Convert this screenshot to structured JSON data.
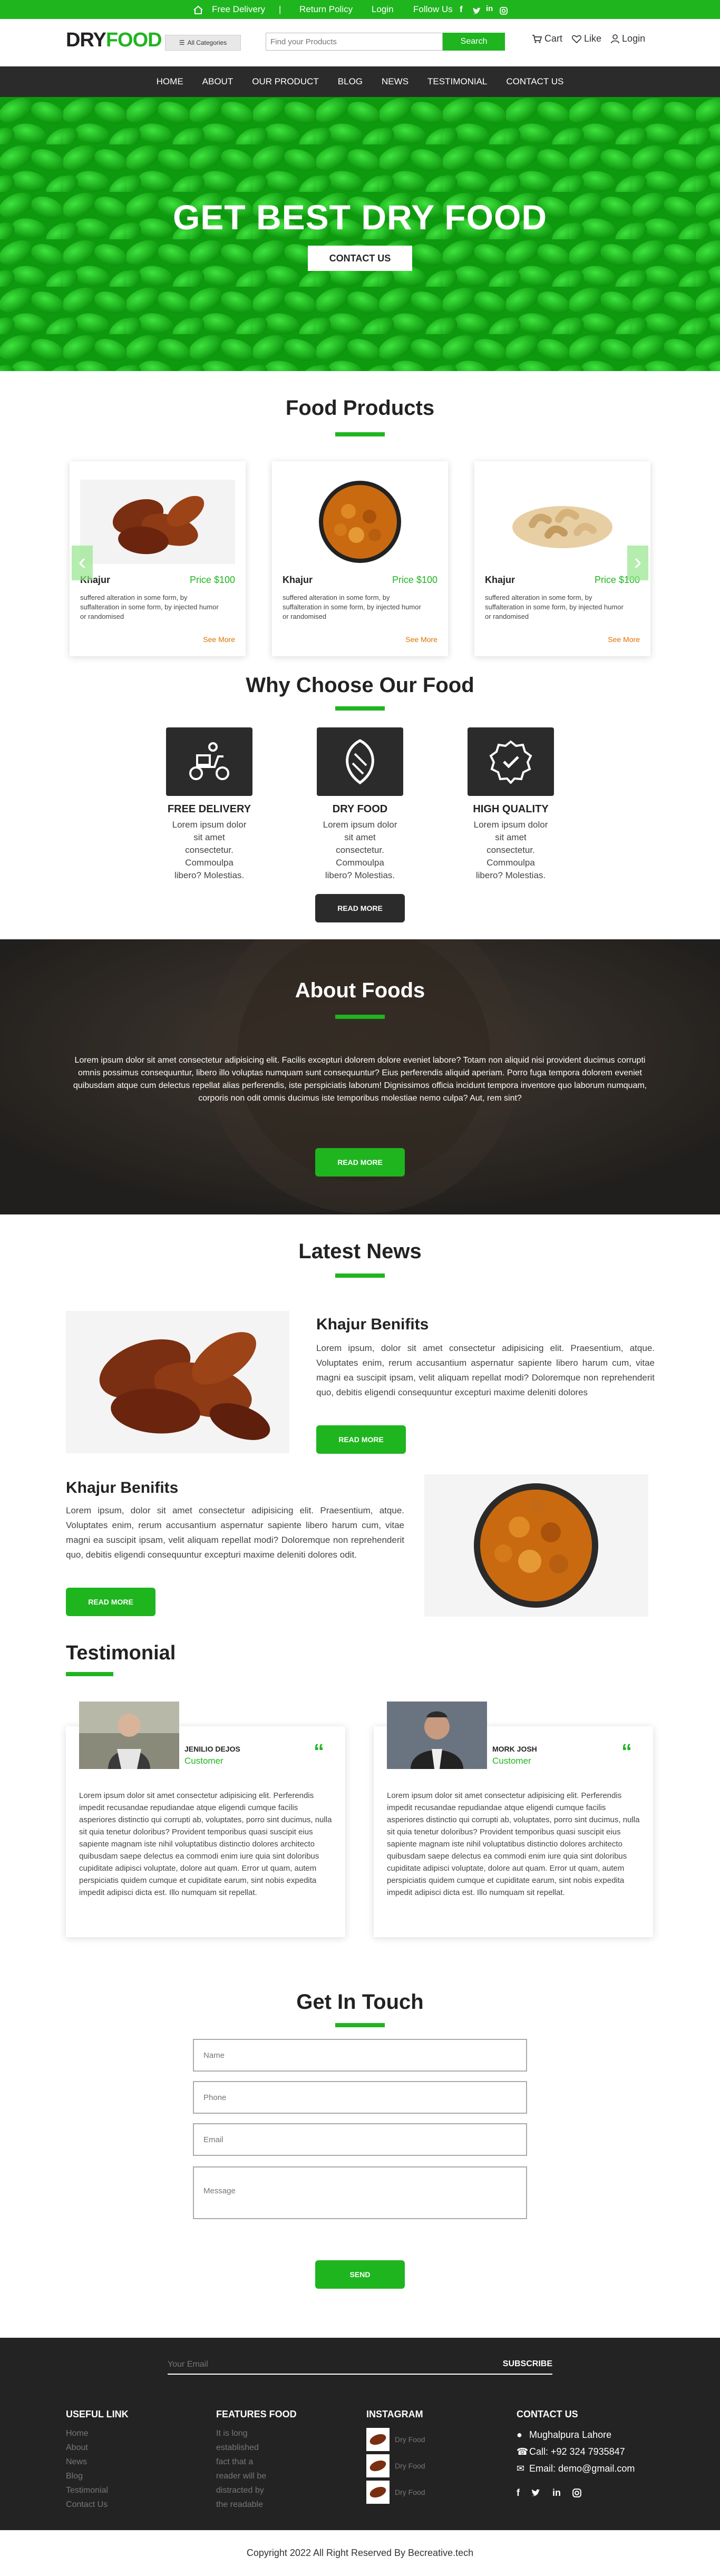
{
  "topbar": {
    "delivery": "Free Delivery",
    "separator": "|",
    "return": "Return Policy",
    "login": "Login",
    "follow": "Follow Us"
  },
  "header": {
    "logo_dry": "DRY",
    "logo_food": "FOOD",
    "categories": "All Categories",
    "search_placeholder": "Find your Products",
    "search_button": "Search",
    "cart": "Cart",
    "like": "Like",
    "login": "Login"
  },
  "nav": [
    "HOME",
    "ABOUT",
    "OUR PRODUCT",
    "BLOG",
    "NEWS",
    "TESTIMONIAL",
    "CONTACT US"
  ],
  "hero": {
    "title": "GET BEST DRY FOOD",
    "button": "CONTACT US"
  },
  "products": {
    "title": "Food Products",
    "items": [
      {
        "name": "Khajur",
        "price": "Price $100",
        "desc": "suffered alteration in some form, by suffalteration in some form, by injected humor or randomised",
        "more": "See More"
      },
      {
        "name": "Khajur",
        "price": "Price $100",
        "desc": "suffered alteration in some form, by suffalteration in some form, by injected humor or randomised",
        "more": "See More"
      },
      {
        "name": "Khajur",
        "price": "Price $100",
        "desc": "suffered alteration in some form, by suffalteration in some form, by injected humor or randomised",
        "more": "See More"
      }
    ]
  },
  "why": {
    "title": "Why Choose Our Food",
    "items": [
      {
        "title": "FREE DELIVERY",
        "text": "Lorem ipsum dolor sit amet consectetur. Commoulpa libero? Molestias.",
        "icon": "delivery-scooter-icon"
      },
      {
        "title": "DRY FOOD",
        "text": "Lorem ipsum dolor sit amet consectetur. Commoulpa libero? Molestias.",
        "icon": "almond-icon"
      },
      {
        "title": "HIGH QUALITY",
        "text": "Lorem ipsum dolor sit amet consectetur. Commoulpa libero? Molestias.",
        "icon": "quality-badge-icon"
      }
    ],
    "button": "READ MORE"
  },
  "about": {
    "title": "About Foods",
    "text": "Lorem ipsum dolor sit amet consectetur adipisicing elit. Facilis excepturi dolorem dolore eveniet labore? Totam non aliquid nisi provident ducimus corrupti omnis possimus consequuntur, libero illo voluptas numquam sunt consequuntur? Eius perferendis aliquid aperiam. Porro fuga tempora dolorem eveniet quibusdam atque cum delectus repellat alias perferendis, iste perspiciatis laborum! Dignissimos officia incidunt tempora inventore quo laborum numquam, corporis non odit omnis ducimus iste temporibus molestiae nemo culpa? Aut, rem sint?",
    "button": "READ MORE"
  },
  "news": {
    "title": "Latest News",
    "items": [
      {
        "title": "Khajur Benifits",
        "text": "Lorem ipsum, dolor sit amet consectetur adipisicing elit. Praesentium, atque. Voluptates enim, rerum accusantium aspernatur sapiente libero harum cum, vitae magni ea suscipit ipsam, velit aliquam repellat modi? Doloremque non reprehenderit quo, debitis eligendi consequuntur excepturi maxime deleniti dolores",
        "button": "READ MORE"
      },
      {
        "title": "Khajur Benifits",
        "text": "Lorem ipsum, dolor sit amet consectetur adipisicing elit. Praesentium, atque. Voluptates enim, rerum accusantium aspernatur sapiente libero harum cum, vitae magni ea suscipit ipsam, velit aliquam repellat modi? Doloremque non reprehenderit quo, debitis eligendi consequuntur excepturi maxime deleniti dolores odit.",
        "button": "READ MORE"
      }
    ]
  },
  "testimonial": {
    "title": "Testimonial",
    "items": [
      {
        "name": "JENILIO DEJOS",
        "role": "Customer",
        "text": "Lorem ipsum dolor sit amet consectetur adipisicing elit. Perferendis impedit recusandae repudiandae atque eligendi cumque facilis asperiores distinctio qui corrupti ab, voluptates, porro sint ducimus, nulla sit quia tenetur doloribus? Provident temporibus quasi suscipit eius sapiente magnam iste nihil voluptatibus distinctio dolores architecto quibusdam saepe delectus ea commodi enim iure quia sint doloribus cupiditate adipisci voluptate, dolore aut quam. Error ut quam, autem perspiciatis quidem cumque et cupiditate earum, sint nobis expedita impedit adipisci dicta est. Illo numquam sit repellat."
      },
      {
        "name": "MORK JOSH",
        "role": "Customer",
        "text": "Lorem ipsum dolor sit amet consectetur adipisicing elit. Perferendis impedit recusandae repudiandae atque eligendi cumque facilis asperiores distinctio qui corrupti ab, voluptates, porro sint ducimus, nulla sit quia tenetur doloribus? Provident temporibus quasi suscipit eius sapiente magnam iste nihil voluptatibus distinctio dolores architecto quibusdam saepe delectus ea commodi enim iure quia sint doloribus cupiditate adipisci voluptate, dolore aut quam. Error ut quam, autem perspiciatis quidem cumque et cupiditate earum, sint nobis expedita impedit adipisci dicta est. Illo numquam sit repellat."
      }
    ]
  },
  "contact": {
    "title": "Get In Touch",
    "name": "Name",
    "phone": "Phone",
    "email": "Email",
    "message": "Message",
    "button": "SEND"
  },
  "footer": {
    "email_placeholder": "Your Email",
    "subscribe": "SUBSCRIBE",
    "useful_title": "USEFUL LINK",
    "useful_links": [
      "Home",
      "About",
      "News",
      "Blog",
      "Testimonial",
      "Contact Us"
    ],
    "features_title": "FEATURES FOOD",
    "features_text": [
      "It is long",
      "established",
      "fact that a",
      "reader will be",
      "distracted by",
      "the readable"
    ],
    "instagram_title": "INSTAGRAM",
    "instagram_items": [
      "Dry Food",
      "Dry Food",
      "Dry Food"
    ],
    "contact_title": "CONTACT US",
    "address": "Mughalpura Lahore",
    "phone": "Call: +92 324 7935847",
    "email": "Email: demo@gmail.com"
  },
  "copyright": "Copyright 2022 All Right Reserved By Becreative.tech"
}
